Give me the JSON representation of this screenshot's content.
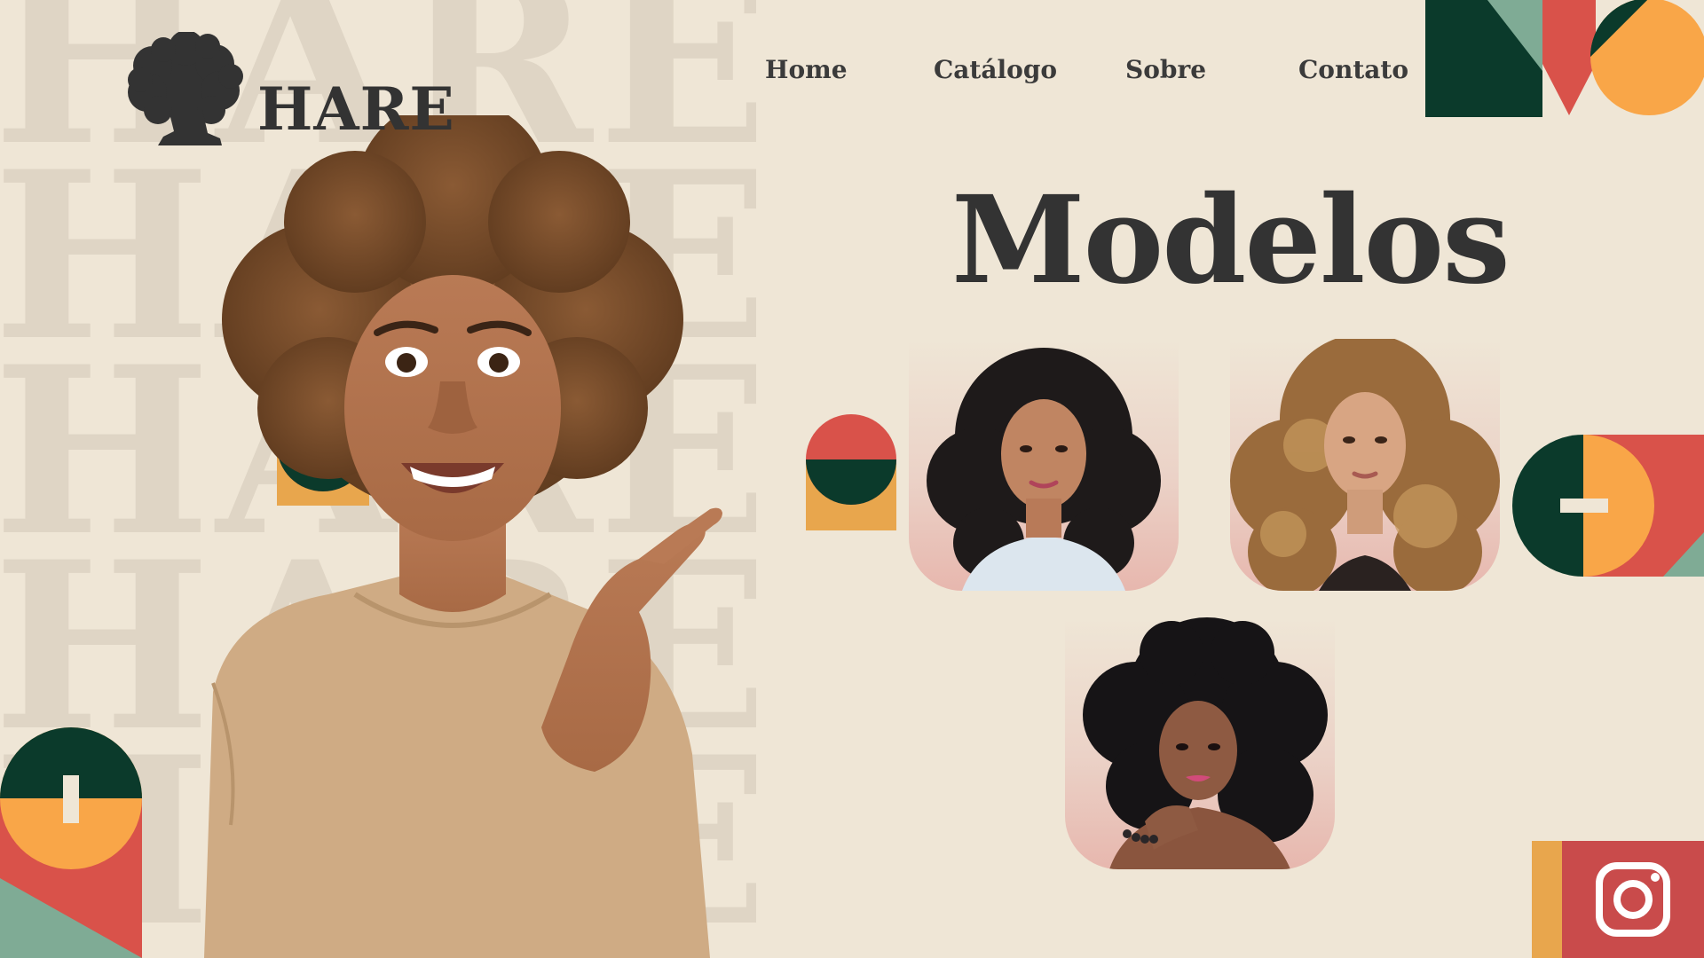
{
  "brand": {
    "name": "HARE",
    "watermark_lines": [
      "HARE",
      "HARE",
      "HARE",
      "HARE",
      "HARE"
    ]
  },
  "nav": {
    "items": [
      {
        "label": "Home"
      },
      {
        "label": "Catálogo"
      },
      {
        "label": "Sobre"
      },
      {
        "label": "Contato"
      }
    ]
  },
  "main": {
    "title": "Modelos"
  },
  "models": [
    {
      "hair": "black curly, shoulder length",
      "top": "light blue cardigan"
    },
    {
      "hair": "honey blonde curly, long",
      "top": "black"
    },
    {
      "hair": "black afro curls with bangs",
      "top": "bare shoulders"
    }
  ],
  "social": {
    "icon": "instagram-icon"
  },
  "colors": {
    "background": "#EFE6D6",
    "text": "#333333",
    "watermark": "#DFD5C5",
    "dark_green": "#0B3A2B",
    "sage": "#7FAB95",
    "coral": "#D9524A",
    "orange": "#F9A648",
    "mustard": "#E8A64D"
  }
}
